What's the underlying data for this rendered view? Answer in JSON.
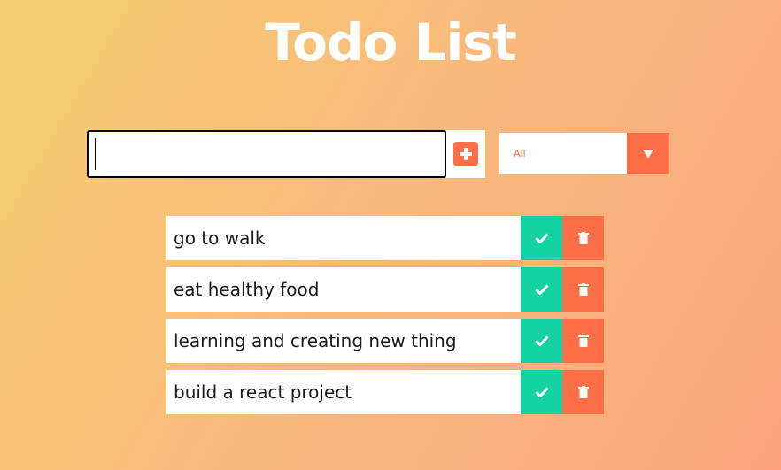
{
  "header": {
    "title": "Todo List"
  },
  "form": {
    "input_value": "",
    "add_icon": "plus-square-icon",
    "filter": {
      "selected": "All",
      "arrow_icon": "caret-down-icon"
    }
  },
  "todos": [
    {
      "text": "go to walk"
    },
    {
      "text": "eat healthy food"
    },
    {
      "text": "learning and creating new thing"
    },
    {
      "text": "build a react project"
    }
  ],
  "colors": {
    "accent": "#ff6f47",
    "complete": "#13d3a3",
    "background_start": "#f6ce72",
    "background_end": "#fba47e"
  }
}
